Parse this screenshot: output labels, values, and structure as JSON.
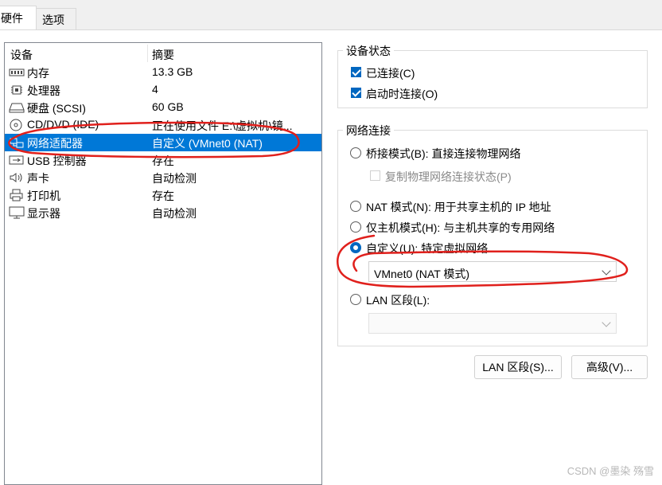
{
  "tabs": [
    {
      "label": "硬件"
    },
    {
      "label": "选项"
    }
  ],
  "device_list": {
    "columns": [
      "设备",
      "摘要"
    ],
    "rows": [
      {
        "name": "内存",
        "summary": "13.3 GB",
        "icon": "memory-icon"
      },
      {
        "name": "处理器",
        "summary": "4",
        "icon": "processor-icon"
      },
      {
        "name": "硬盘 (SCSI)",
        "summary": "60 GB",
        "icon": "hard-disk-icon"
      },
      {
        "name": "CD/DVD (IDE)",
        "summary": "正在使用文件 E:\\虚拟机\\镜...",
        "icon": "cd-dvd-icon"
      },
      {
        "name": "网络适配器",
        "summary": "自定义 (VMnet0 (NAT)",
        "icon": "network-adapter-icon",
        "selected": true
      },
      {
        "name": "USB 控制器",
        "summary": "存在",
        "icon": "usb-icon"
      },
      {
        "name": "声卡",
        "summary": "自动检测",
        "icon": "speaker-icon"
      },
      {
        "name": "打印机",
        "summary": "存在",
        "icon": "printer-icon"
      },
      {
        "name": "显示器",
        "summary": "自动检测",
        "icon": "display-icon"
      }
    ]
  },
  "device_status": {
    "title": "设备状态",
    "connected": {
      "label": "已连接(C)",
      "checked": true
    },
    "connect_at_power_on": {
      "label": "启动时连接(O)",
      "checked": true
    }
  },
  "network_connection": {
    "title": "网络连接",
    "bridged": {
      "label": "桥接模式(B): 直接连接物理网络",
      "selected": false
    },
    "replicate": {
      "label": "复制物理网络连接状态(P)",
      "checked": false
    },
    "nat": {
      "label": "NAT 模式(N): 用于共享主机的 IP 地址",
      "selected": false
    },
    "host_only": {
      "label": "仅主机模式(H): 与主机共享的专用网络",
      "selected": false
    },
    "custom": {
      "label": "自定义(U): 特定虚拟网络",
      "selected": true
    },
    "custom_select_value": "VMnet0 (NAT 模式)",
    "lan_segment": {
      "label": "LAN 区段(L):",
      "selected": false
    },
    "lan_select_value": ""
  },
  "buttons": {
    "lan_segments": "LAN 区段(S)...",
    "advanced": "高级(V)..."
  },
  "watermark": "CSDN @墨染 殇雪",
  "colors": {
    "selection": "#0078d7",
    "checkbox": "#0067c0",
    "annotation": "#e0201c"
  }
}
